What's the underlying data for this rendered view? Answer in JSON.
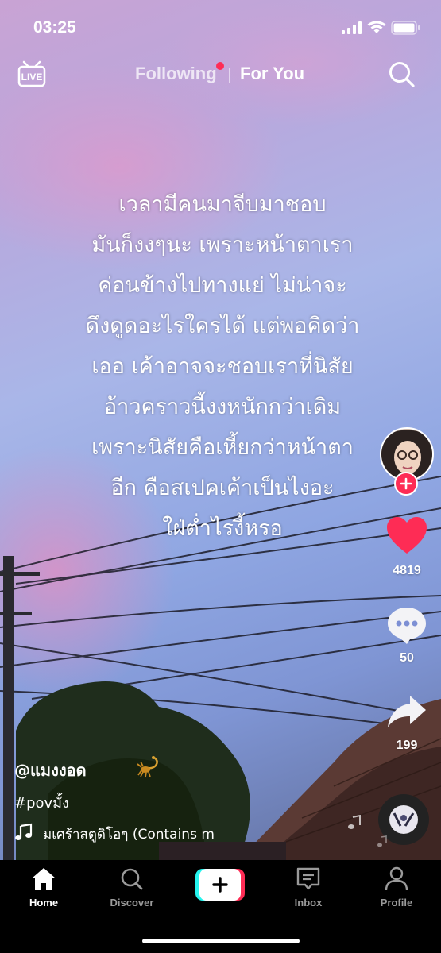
{
  "status_bar": {
    "time": "03:25"
  },
  "top_nav": {
    "following": "Following",
    "for_you": "For You"
  },
  "caption_lines": [
    "เวลามีคนมาจีบมาชอบ",
    "มันก็งงๆนะ เพราะหน้าตาเรา",
    "ค่อนข้างไปทางแย่ ไม่น่าจะ",
    "ดึงดูดอะไรใครได้ แต่พอคิดว่า",
    "เออ เค้าอาจจะชอบเราที่นิสัย",
    "อ้าวคราวนี้งงหนักกว่าเดิม",
    "เพราะนิสัยคือเหี้ยกว่าหน้าตา",
    "อีก คือสเปคเค้าเป็นไงอะ",
    "ใฝ่ต่ำไรงี้หรอ"
  ],
  "actions": {
    "likes": "4819",
    "comments": "50",
    "shares": "199"
  },
  "post": {
    "username": "@แมงงอด",
    "hashtag": "#povมั้ง",
    "music": "มเศร้าสตูดิโอๆ (Contains m"
  },
  "tabbar": {
    "home": "Home",
    "discover": "Discover",
    "inbox": "Inbox",
    "profile": "Profile"
  },
  "colors": {
    "accent": "#fe2c55",
    "cyan": "#25f4ee",
    "like": "#fe2c55"
  },
  "icons": [
    "live-icon",
    "search-icon",
    "heart-icon",
    "comment-icon",
    "share-icon",
    "music-note-icon",
    "home-icon",
    "discover-icon",
    "create-icon",
    "inbox-icon",
    "profile-icon"
  ]
}
